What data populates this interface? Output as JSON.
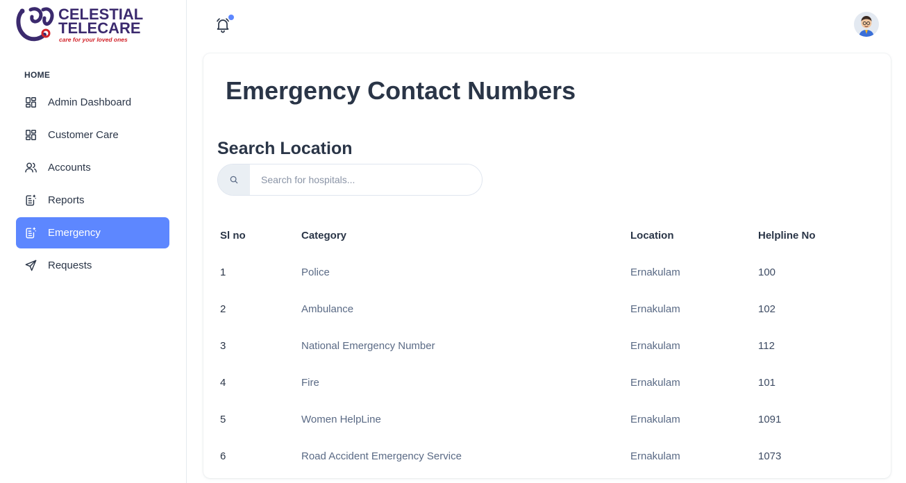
{
  "brand": {
    "line1": "CELESTIAL",
    "line2": "TELECARE",
    "tagline": "care for your loved ones",
    "colors": {
      "primary": "#3b2a6e",
      "accent": "#d2232a"
    }
  },
  "sidebar": {
    "caption": "HOME",
    "items": [
      {
        "label": "Admin Dashboard",
        "icon": "dashboard-icon",
        "active": false
      },
      {
        "label": "Customer Care",
        "icon": "dashboard-icon",
        "active": false
      },
      {
        "label": "Accounts",
        "icon": "users-icon",
        "active": false
      },
      {
        "label": "Reports",
        "icon": "report-icon",
        "active": false
      },
      {
        "label": "Emergency",
        "icon": "report-icon",
        "active": true
      },
      {
        "label": "Requests",
        "icon": "send-icon",
        "active": false
      }
    ]
  },
  "topbar": {
    "notification_icon": "bell-icon",
    "has_unread": true,
    "avatar_icon": "user-avatar"
  },
  "main": {
    "title": "Emergency Contact Numbers",
    "search": {
      "label": "Search Location",
      "placeholder": "Search for hospitals...",
      "value": ""
    },
    "table": {
      "headers": [
        "Sl no",
        "Category",
        "Location",
        "Helpline No"
      ],
      "rows": [
        [
          "1",
          "Police",
          "Ernakulam",
          "100"
        ],
        [
          "2",
          "Ambulance",
          "Ernakulam",
          "102"
        ],
        [
          "3",
          "National Emergency Number",
          "Ernakulam",
          "112"
        ],
        [
          "4",
          "Fire",
          "Ernakulam",
          "101"
        ],
        [
          "5",
          "Women HelpLine",
          "Ernakulam",
          "1091"
        ],
        [
          "6",
          "Road Accident Emergency Service",
          "Ernakulam",
          "1073"
        ]
      ]
    }
  },
  "colors": {
    "active": "#5d87ff",
    "text": "#2a3547",
    "muted": "#5a6a85"
  }
}
